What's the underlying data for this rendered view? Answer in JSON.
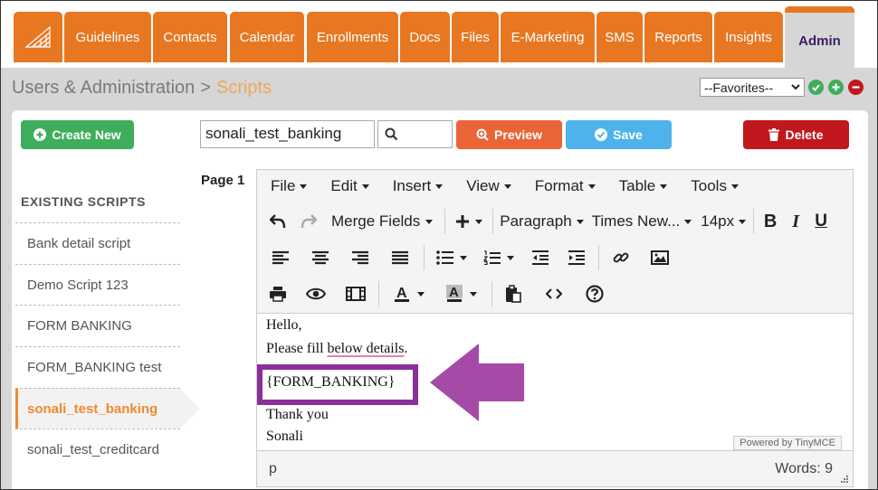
{
  "nav": {
    "logo_icon": "app-logo-icon",
    "items": [
      {
        "label": "Guidelines"
      },
      {
        "label": "Contacts"
      },
      {
        "label": "Calendar"
      },
      {
        "label": "Enrollments"
      },
      {
        "label": "Docs"
      },
      {
        "label": "Files"
      },
      {
        "label": "E-Marketing"
      },
      {
        "label": "SMS"
      },
      {
        "label": "Reports"
      },
      {
        "label": "Insights"
      },
      {
        "label": "Admin"
      }
    ],
    "active": "Admin"
  },
  "header": {
    "breadcrumb_root": "Users & Administration",
    "breadcrumb_sep": ">",
    "breadcrumb_current": "Scripts",
    "favorites_value": "--Favorites--"
  },
  "actions": {
    "create_label": "Create New",
    "preview_label": "Preview",
    "save_label": "Save",
    "delete_label": "Delete"
  },
  "script_name_value": "sonali_test_banking",
  "sidebar": {
    "title": "EXISTING SCRIPTS",
    "items": [
      {
        "label": "Bank detail script"
      },
      {
        "label": "Demo Script 123"
      },
      {
        "label": "FORM BANKING"
      },
      {
        "label": "FORM_BANKING test"
      },
      {
        "label": "sonali_test_banking"
      },
      {
        "label": "sonali_test_creditcard"
      }
    ],
    "active_item": "sonali_test_banking"
  },
  "page_label": "Page 1",
  "editor": {
    "menus": [
      {
        "label": "File"
      },
      {
        "label": "Edit"
      },
      {
        "label": "Insert"
      },
      {
        "label": "View"
      },
      {
        "label": "Format"
      },
      {
        "label": "Table"
      },
      {
        "label": "Tools"
      }
    ],
    "merge_fields_label": "Merge Fields",
    "block_format": "Paragraph",
    "font_family": "Times New...",
    "font_size": "14px",
    "content_lines": {
      "line1": "Hello,",
      "line2_start": "Please fill ",
      "line2_underlined": "below details",
      "line2_end": ".",
      "line3": "{FORM_BANKING}",
      "line4": "Thank you",
      "line5": "Sonali"
    },
    "powered_by": "Powered by TinyMCE",
    "status_path": "p",
    "word_count": "Words: 9"
  },
  "colors": {
    "nav_orange": "#e87722",
    "annotation_purple": "#8b2f9b",
    "create_green": "#3fae5c",
    "preview_orange": "#ea6437",
    "save_blue": "#4db3ea",
    "delete_red": "#c0181d"
  }
}
